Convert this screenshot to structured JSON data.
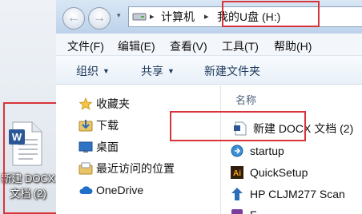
{
  "desktop": {
    "file_label_line1": "新建 DOCX",
    "file_label_line2": "文档 (2)",
    "file_icon_letter": "W"
  },
  "explorer": {
    "nav": {
      "back_glyph": "←",
      "forward_glyph": "→",
      "dropdown_glyph": "▾"
    },
    "address": {
      "sep1": "▸",
      "computer": "计算机",
      "sep2": "▸",
      "drive": "我的U盘 (H:)"
    },
    "menu": {
      "file": "文件(F)",
      "edit": "编辑(E)",
      "view": "查看(V)",
      "tools": "工具(T)",
      "help": "帮助(H)"
    },
    "toolbar": {
      "organize": "组织",
      "share": "共享",
      "new_folder": "新建文件夹",
      "caret": "▼"
    },
    "navpane": {
      "favorites": "收藏夹",
      "downloads": "下载",
      "desktop": "桌面",
      "recent": "最近访问的位置",
      "onedrive": "OneDrive"
    },
    "content": {
      "column_name": "名称",
      "files": [
        {
          "name": "新建 DOCX 文档 (2)",
          "icon": "doc-icon"
        },
        {
          "name": "startup",
          "icon": "startup-icon"
        },
        {
          "name": "QuickSetup",
          "icon": "ai-icon"
        },
        {
          "name": "HP CLJM277 Scan",
          "icon": "hp-arrow-icon"
        },
        {
          "name": "F",
          "icon": "generic-icon"
        }
      ]
    }
  },
  "colors": {
    "highlight": "#d8353b",
    "word_blue": "#2b5797"
  }
}
